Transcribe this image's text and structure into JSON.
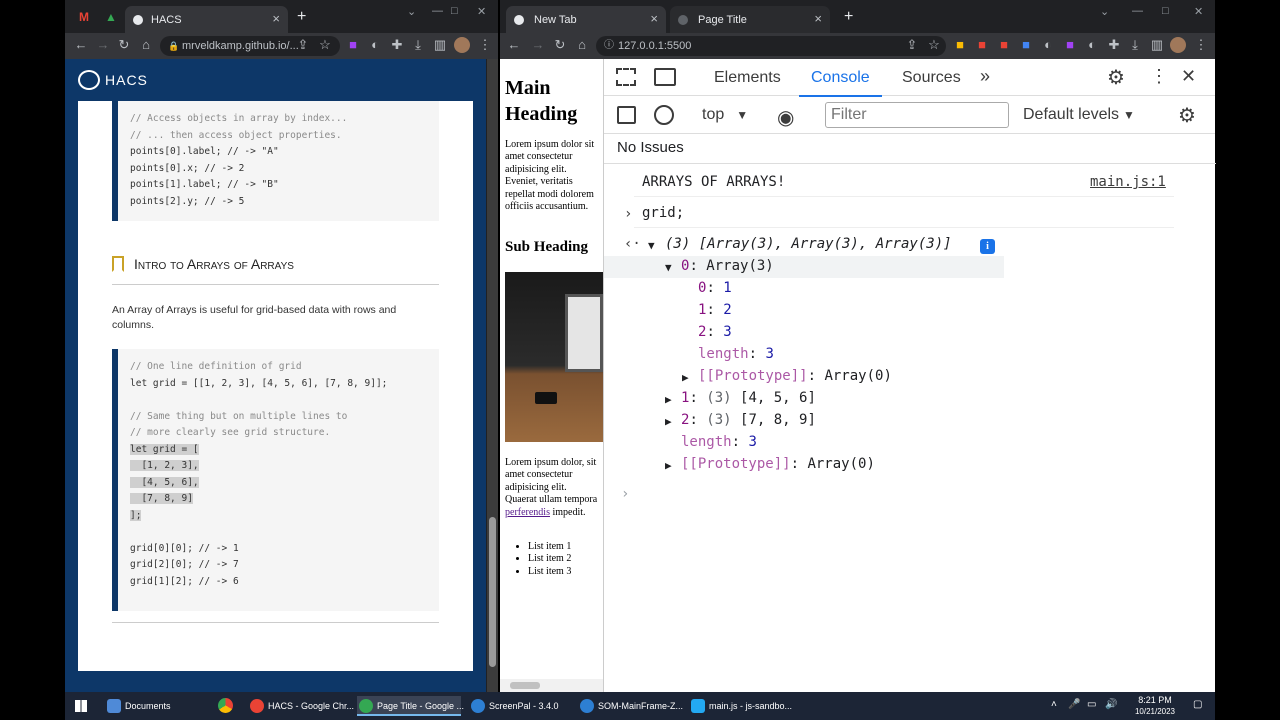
{
  "left_browser": {
    "tabs": [
      {
        "label": "HACS"
      }
    ],
    "url": "mrveldkamp.github.io/...",
    "site_title": "HACS",
    "code_block_1": [
      "// Access objects in array by index...",
      "// ... then access object properties.",
      "points[0].label; // -> \"A\"",
      "points[0].x; // -> 2",
      "points[1].label; // -> \"B\"",
      "points[2].y; // -> 5"
    ],
    "section_heading": "Intro to Arrays of Arrays",
    "section_text": "An Array of Arrays is useful for grid-based data with rows and columns.",
    "code_block_2": [
      "// One line definition of grid",
      "let grid = [[1, 2, 3], [4, 5, 6], [7, 8, 9]];",
      "",
      "// Same thing but on multiple lines to",
      "// more clearly see grid structure.",
      "let grid = [",
      "  [1, 2, 3],",
      "  [4, 5, 6],",
      "  [7, 8, 9]",
      "];",
      "",
      "grid[0][0]; // -> 1",
      "grid[2][0]; // -> 7",
      "grid[1][2]; // -> 6"
    ]
  },
  "right_browser": {
    "tabs": [
      {
        "label": "New Tab"
      },
      {
        "label": "Page Title"
      }
    ],
    "url": "127.0.0.1:5500",
    "preview": {
      "main_heading": "Main Heading",
      "para1": "Lorem ipsum dolor sit amet consectetur adipisicing elit. Eveniet, veritatis repellat modi dolorem officiis accusantium.",
      "sub_heading": "Sub Heading",
      "para2_start": "Lorem ipsum dolor, sit amet consectetur adipisicing elit. Quaerat ullam tempora",
      "para2_link": "perferendis",
      "para2_end": "impedit.",
      "list": [
        "List item 1",
        "List item 2",
        "List item 3"
      ]
    },
    "devtools": {
      "tabs": [
        "Elements",
        "Console",
        "Sources"
      ],
      "context": "top",
      "filter_placeholder": "Filter",
      "levels": "Default levels",
      "issues": "No Issues",
      "log_message": "ARRAYS OF ARRAYS!",
      "log_source": "main.js:1",
      "input_expression": "grid;",
      "result_summary": "(3) [Array(3), Array(3), Array(3)]",
      "tree": {
        "row0_key": "0",
        "row0_val": "Array(3)",
        "row0_items": [
          {
            "k": "0",
            "v": "1"
          },
          {
            "k": "1",
            "v": "2"
          },
          {
            "k": "2",
            "v": "3"
          }
        ],
        "row0_length_key": "length",
        "row0_length_val": "3",
        "proto_key": "[[Prototype]]",
        "proto_val": "Array(0)",
        "row1_key": "1",
        "row1_count": "(3)",
        "row1_val": "[4, 5, 6]",
        "row2_key": "2",
        "row2_count": "(3)",
        "row2_val": "[7, 8, 9]",
        "length_key": "length",
        "length_val": "3"
      }
    }
  },
  "taskbar": {
    "items": [
      "Documents",
      "HACS - Google Chr...",
      "Page Title - Google ...",
      "ScreenPal - 3.4.0",
      "SOM-MainFrame-Z...",
      "main.js - js-sandbo..."
    ],
    "time": "8:21 PM",
    "date": "10/21/2023"
  }
}
